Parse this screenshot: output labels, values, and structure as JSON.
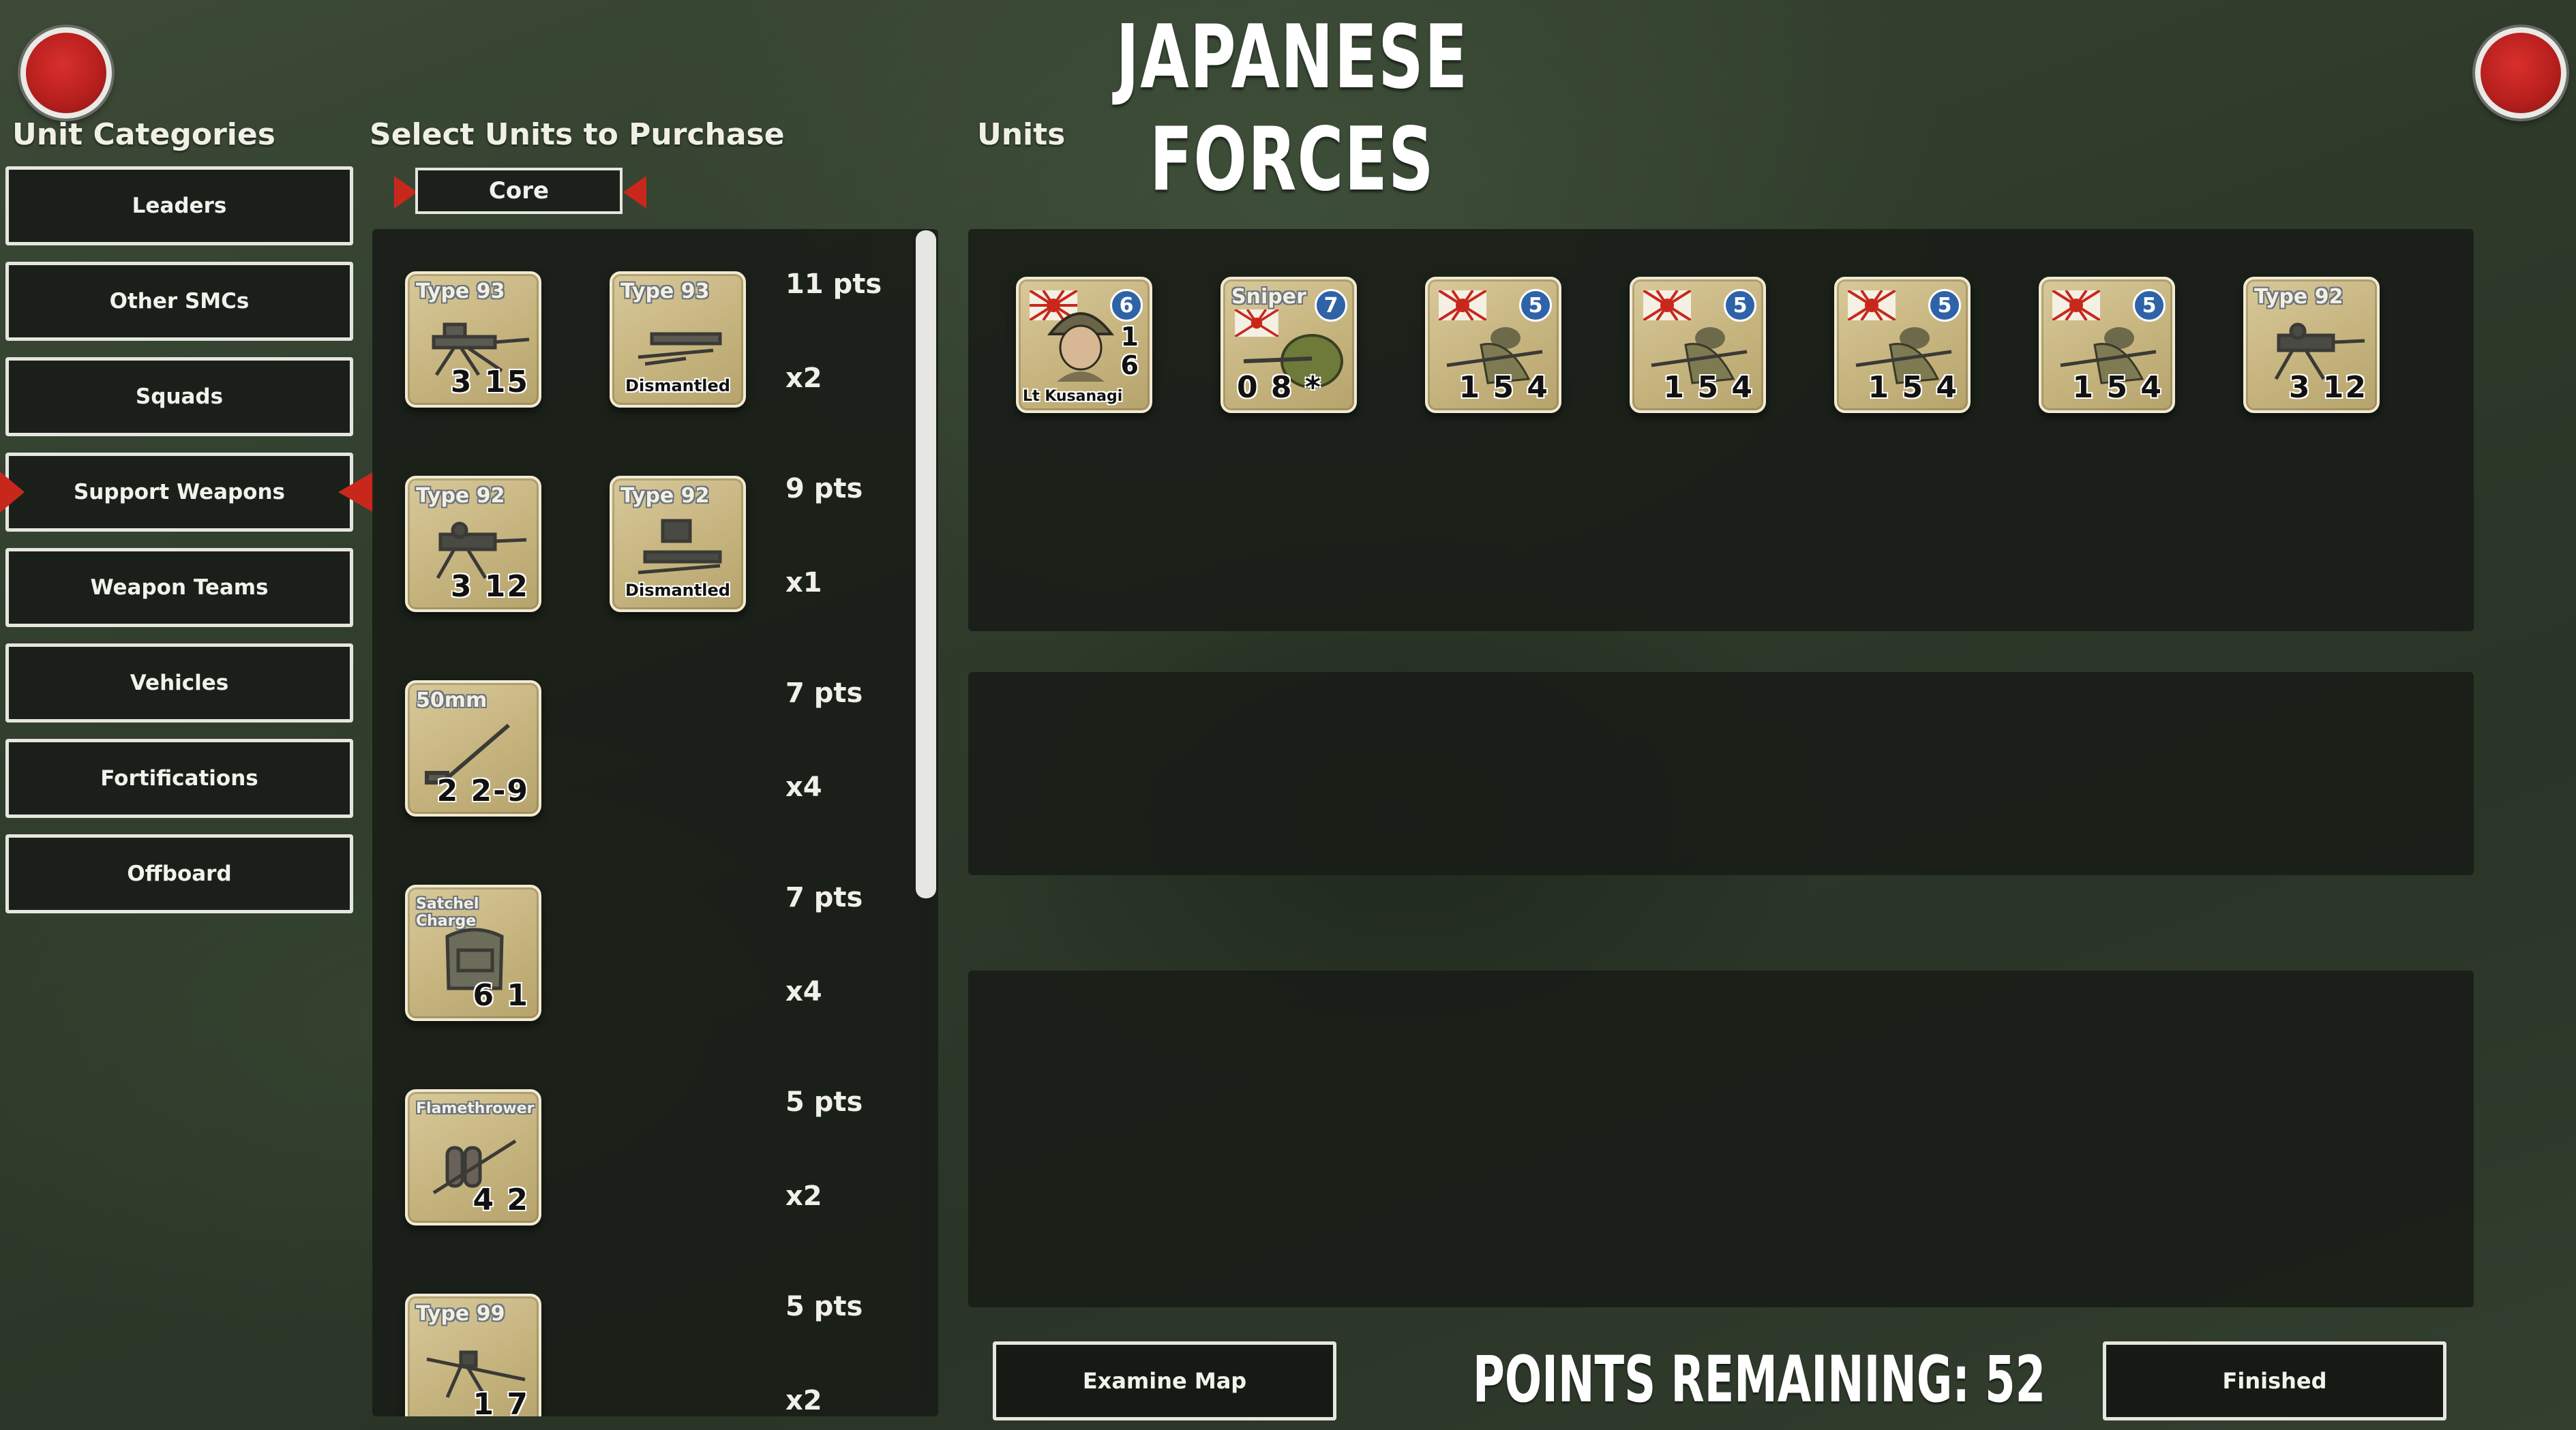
{
  "title": "JAPANESE FORCES",
  "sections": {
    "categories": "Unit Categories",
    "select": "Select Units to Purchase",
    "units": "Units"
  },
  "categories": [
    {
      "label": "Leaders"
    },
    {
      "label": "Other SMCs"
    },
    {
      "label": "Squads"
    },
    {
      "label": "Support Weapons",
      "selected": true
    },
    {
      "label": "Weapon Teams"
    },
    {
      "label": "Vehicles"
    },
    {
      "label": "Fortifications"
    },
    {
      "label": "Offboard"
    }
  ],
  "tab": {
    "label": "Core"
  },
  "purchase_rows": [
    {
      "name": "Type 93",
      "stats": "3 15",
      "dismantled_name": "Type 93",
      "dismantled_label": "Dismantled",
      "points": "11 pts",
      "qty": "x2"
    },
    {
      "name": "Type 92",
      "stats": "3 12",
      "dismantled_name": "Type 92",
      "dismantled_label": "Dismantled",
      "points": "9 pts",
      "qty": "x1"
    },
    {
      "name": "50mm",
      "stats": "2 2-9",
      "points": "7 pts",
      "qty": "x4"
    },
    {
      "name": "Satchel Charge",
      "stats": "6 1",
      "points": "7 pts",
      "qty": "x4"
    },
    {
      "name": "Flamethrower",
      "stats": "4 2",
      "points": "5 pts",
      "qty": "x2"
    },
    {
      "name": "Type 99",
      "stats": "1 7",
      "points": "5 pts",
      "qty": "x2"
    }
  ],
  "purchased_units": [
    {
      "kind": "leader",
      "name": "Lt Kusanagi",
      "morale": "6",
      "mod1": "1",
      "mod2": "6"
    },
    {
      "kind": "sniper",
      "name": "Sniper",
      "morale": "7",
      "stats": "0 8 *"
    },
    {
      "kind": "squad",
      "morale": "5",
      "stats": "1 5 4"
    },
    {
      "kind": "squad",
      "morale": "5",
      "stats": "1 5 4"
    },
    {
      "kind": "squad",
      "morale": "5",
      "stats": "1 5 4"
    },
    {
      "kind": "squad",
      "morale": "5",
      "stats": "1 5 4"
    },
    {
      "kind": "weapon",
      "name": "Type 92",
      "stats": "3 12"
    }
  ],
  "buttons": {
    "examine_map": "Examine Map",
    "finished": "Finished"
  },
  "points_remaining": "POINTS REMAINING: 52",
  "colors": {
    "accent_red": "#c8281c",
    "counter_tan": "#c6b47f",
    "morale_blue": "#2e63a8"
  }
}
